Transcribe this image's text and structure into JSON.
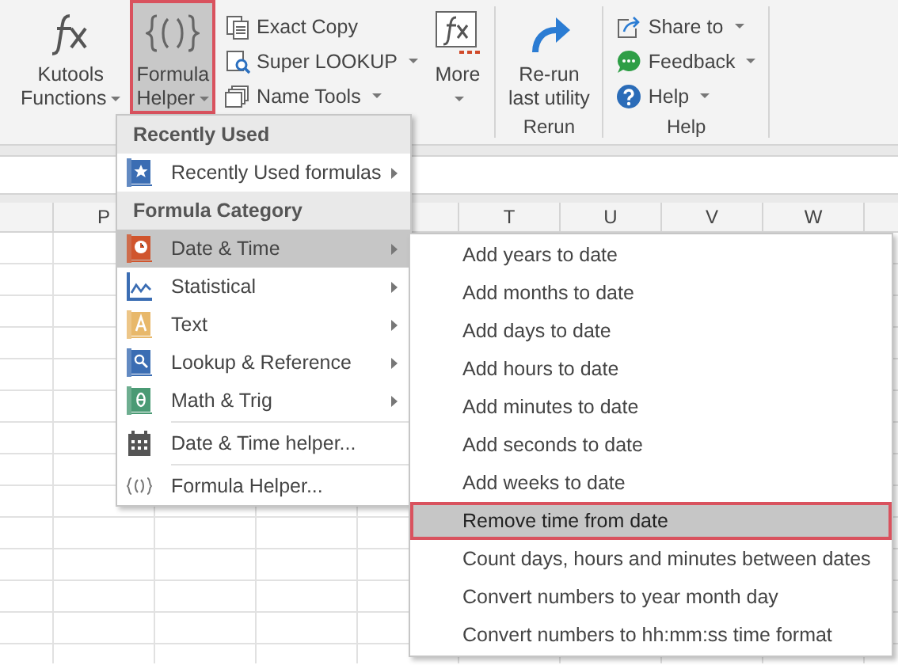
{
  "ribbon": {
    "groups": [
      {
        "buttons": [
          {
            "kind": "large",
            "label": "Kutools",
            "label2": "Functions",
            "dropdown": true,
            "selected": false
          },
          {
            "kind": "large",
            "label": "Formula",
            "label2": "Helper",
            "dropdown": true,
            "selected": true
          },
          {
            "kind": "small",
            "label": "Exact Copy",
            "dropdown": false,
            "selected": false
          },
          {
            "kind": "small",
            "label": "Super LOOKUP",
            "dropdown": true,
            "selected": false
          },
          {
            "kind": "small",
            "label": "Name Tools",
            "dropdown": true,
            "selected": false
          },
          {
            "kind": "large",
            "label": "More",
            "dropdown": true,
            "selected": false
          }
        ]
      },
      {
        "label": "Rerun",
        "buttons": [
          {
            "kind": "large",
            "label": "Re-run",
            "label2": "last utility",
            "dropdown": false,
            "selected": false
          }
        ]
      },
      {
        "label": "Help",
        "buttons": [
          {
            "kind": "small",
            "label": "Share to",
            "dropdown": true,
            "selected": false
          },
          {
            "kind": "small",
            "label": "Feedback",
            "dropdown": true,
            "selected": false
          },
          {
            "kind": "small",
            "label": "Help",
            "dropdown": true,
            "selected": false
          }
        ]
      }
    ]
  },
  "columns": [
    "P",
    "T",
    "U",
    "V",
    "W"
  ],
  "menu": [
    {
      "kind": "header",
      "label": "Recently Used"
    },
    {
      "kind": "item",
      "label": "Recently Used formulas",
      "submenu": true,
      "selected": false
    },
    {
      "kind": "header",
      "label": "Formula Category"
    },
    {
      "kind": "item",
      "label": "Date & Time",
      "submenu": true,
      "selected": true
    },
    {
      "kind": "item",
      "label": "Statistical",
      "submenu": true,
      "selected": false
    },
    {
      "kind": "item",
      "label": "Text",
      "submenu": true,
      "selected": false
    },
    {
      "kind": "item",
      "label": "Lookup & Reference",
      "submenu": true,
      "selected": false
    },
    {
      "kind": "item",
      "label": "Math & Trig",
      "submenu": true,
      "selected": false
    },
    {
      "kind": "separator"
    },
    {
      "kind": "item",
      "label": "Date & Time helper...",
      "submenu": false,
      "selected": false
    },
    {
      "kind": "separator"
    },
    {
      "kind": "item",
      "label": "Formula Helper...",
      "submenu": false,
      "selected": false
    }
  ],
  "submenu": [
    {
      "label": "Add years to date",
      "selected": false
    },
    {
      "label": "Add months to date",
      "selected": false
    },
    {
      "label": "Add days to date",
      "selected": false
    },
    {
      "label": "Add hours to date",
      "selected": false
    },
    {
      "label": "Add minutes to date",
      "selected": false
    },
    {
      "label": "Add seconds to date",
      "selected": false
    },
    {
      "label": "Add weeks to date",
      "selected": false
    },
    {
      "label": "Remove time from date",
      "selected": true
    },
    {
      "label": "Count days, hours and minutes between dates",
      "selected": false
    },
    {
      "label": "Convert numbers to year month day",
      "selected": false
    },
    {
      "label": "Convert numbers to hh:mm:ss time format",
      "selected": false
    }
  ]
}
